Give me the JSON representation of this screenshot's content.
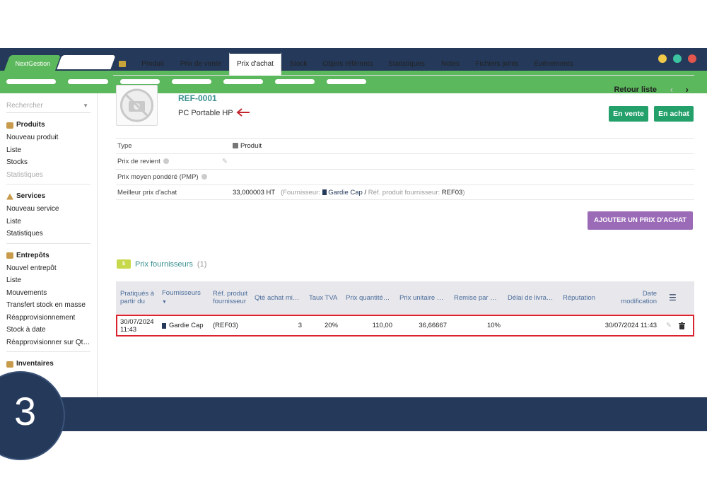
{
  "app": {
    "tab_title": "NextGestion"
  },
  "window_dots": [
    "#f0c948",
    "#3cc3a0",
    "#e3564d"
  ],
  "sidebar": {
    "search_placeholder": "Rechercher",
    "sections": [
      {
        "title": "Produits",
        "items": [
          "Nouveau produit",
          "Liste",
          "Stocks",
          "Statistiques"
        ]
      },
      {
        "title": "Services",
        "items": [
          "Nouveau service",
          "Liste",
          "Statistiques"
        ]
      },
      {
        "title": "Entrepôts",
        "items": [
          "Nouvel entrepôt",
          "Liste",
          "Mouvements",
          "Transfert stock en masse",
          "Réapprovisionnement",
          "Stock à date",
          "Réapprovisionner sur Qt…"
        ]
      },
      {
        "title": "Inventaires"
      }
    ]
  },
  "step_number": "3",
  "tabs": [
    "Produit",
    "Prix de vente",
    "Prix d'achat",
    "Stock",
    "Objets référents",
    "Statistiques",
    "Notes",
    "Fichiers joints",
    "Événements"
  ],
  "product": {
    "ref": "REF-0001",
    "name": "PC Portable HP",
    "back_label": "Retour liste",
    "badge_sale": "En vente",
    "badge_purchase": "En achat"
  },
  "properties": {
    "type_label": "Type",
    "type_value": "Produit",
    "cost_label": "Prix de revient",
    "pmp_label": "Prix moyen pondéré (PMP)",
    "best_label": "Meilleur prix d'achat",
    "best_price": "33,000003 HT",
    "best_open": "(Fournisseur:",
    "best_supplier": "Gardie Cap",
    "best_sep": "/",
    "best_ref_label": "Réf. produit fournisseur:",
    "best_ref": "REF03",
    "best_close": ")"
  },
  "add_button": "AJOUTER UN PRIX D'ACHAT",
  "suppliers": {
    "money_icon_text": "$",
    "title": "Prix fournisseurs",
    "count": "(1)",
    "columns": {
      "from": "Pratiqués à partir du",
      "supplier": "Fournisseurs",
      "ref": "Réf. produit fournisseur",
      "min_qty": "Qté achat mi…",
      "vat": "Taux TVA",
      "qty_price": "Prix quantité…",
      "unit_price": "Prix unitaire …",
      "discount": "Remise par …",
      "delay": "Délai de livra…",
      "reputation": "Réputation",
      "modified": "Date modification"
    },
    "row": {
      "from": "30/07/2024 11:43",
      "supplier": "Gardie Cap",
      "ref": "(REF03)",
      "min_qty": "3",
      "vat": "20%",
      "qty_price": "110,00",
      "unit_price": "36,66667",
      "discount": "10%",
      "modified": "30/07/2024 11:43"
    }
  }
}
